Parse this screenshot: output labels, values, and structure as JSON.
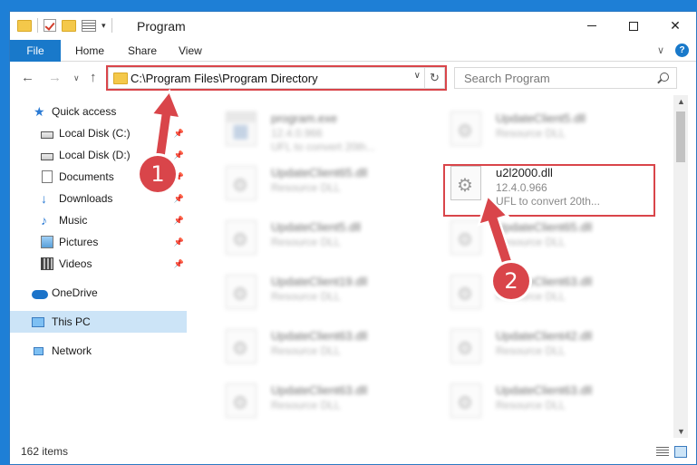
{
  "window": {
    "title": "Program",
    "controls": {
      "minimize": "",
      "maximize": "",
      "close": "✕"
    }
  },
  "ribbon": {
    "tabs": [
      {
        "label": "File"
      },
      {
        "label": "Home"
      },
      {
        "label": "Share"
      },
      {
        "label": "View"
      }
    ]
  },
  "nav": {
    "address": "C:\\Program Files\\Program Directory",
    "search_placeholder": "Search Program"
  },
  "sidebar": {
    "items": [
      {
        "label": "Quick access",
        "icon": "star-icon"
      },
      {
        "label": "Local Disk (C:)",
        "icon": "drive-icon",
        "pinned": true
      },
      {
        "label": "Local Disk (D:)",
        "icon": "drive-icon",
        "pinned": true
      },
      {
        "label": "Documents",
        "icon": "documents-icon",
        "pinned": true
      },
      {
        "label": "Downloads",
        "icon": "downloads-icon",
        "pinned": true
      },
      {
        "label": "Music",
        "icon": "music-icon",
        "pinned": true
      },
      {
        "label": "Pictures",
        "icon": "pictures-icon",
        "pinned": true
      },
      {
        "label": "Videos",
        "icon": "videos-icon",
        "pinned": true
      },
      {
        "label": "OneDrive",
        "icon": "onedrive-icon"
      },
      {
        "label": "This PC",
        "icon": "pc-icon",
        "selected": true
      },
      {
        "label": "Network",
        "icon": "network-icon"
      }
    ]
  },
  "files": [
    {
      "name": "program.exe",
      "line1": "12.4.0.966",
      "line2": "UFL to convert 20th...",
      "blurred": true,
      "type": "exe"
    },
    {
      "name": "UpdateClient5.dll",
      "line1": "Resource DLL",
      "line2": "",
      "blurred": true,
      "type": "dll"
    },
    {
      "name": "UpdateClient65.dll",
      "line1": "Resource DLL",
      "line2": "",
      "blurred": true,
      "type": "dll"
    },
    {
      "name": "u2l2000.dll",
      "line1": "12.4.0.966",
      "line2": "UFL to convert 20th...",
      "blurred": false,
      "type": "dll"
    },
    {
      "name": "UpdateClient5.dll",
      "line1": "Resource DLL",
      "line2": "",
      "blurred": true,
      "type": "dll"
    },
    {
      "name": "UpdateClient65.dll",
      "line1": "Resource DLL",
      "line2": "",
      "blurred": true,
      "type": "dll"
    },
    {
      "name": "UpdateClient19.dll",
      "line1": "Resource DLL",
      "line2": "",
      "blurred": true,
      "type": "dll"
    },
    {
      "name": "UpdateClient63.dll",
      "line1": "Resource DLL",
      "line2": "",
      "blurred": true,
      "type": "dll"
    },
    {
      "name": "UpdateClient63.dll",
      "line1": "Resource DLL",
      "line2": "",
      "blurred": true,
      "type": "dll"
    },
    {
      "name": "UpdateClient42.dll",
      "line1": "Resource DLL",
      "line2": "",
      "blurred": true,
      "type": "dll"
    },
    {
      "name": "UpdateClient63.dll",
      "line1": "Resource DLL",
      "line2": "",
      "blurred": true,
      "type": "dll"
    },
    {
      "name": "UpdateClient63.dll",
      "line1": "Resource DLL",
      "line2": "",
      "blurred": true,
      "type": "dll"
    }
  ],
  "status": {
    "count": "162 items"
  },
  "annotations": {
    "badge1": "1",
    "badge2": "2",
    "color": "#d9454a"
  }
}
